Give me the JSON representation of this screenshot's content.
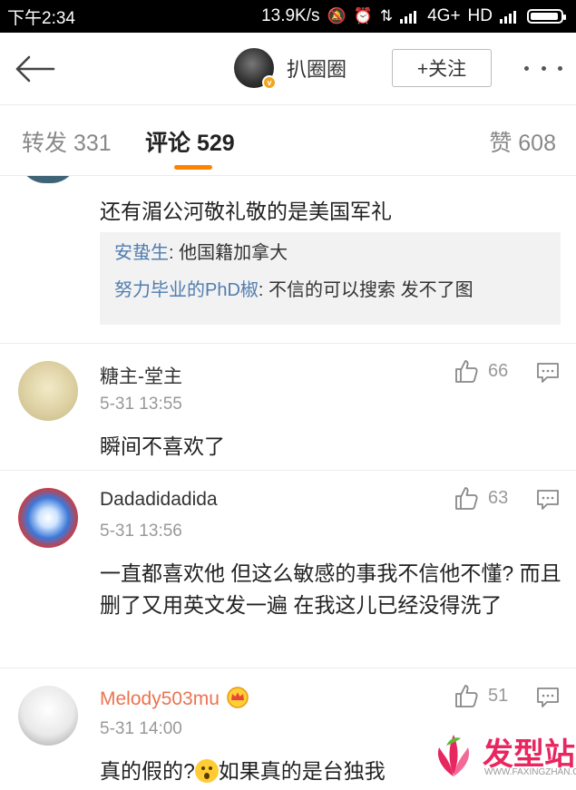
{
  "status_bar": {
    "time": "下午2:34",
    "speed": "13.9K/s",
    "network": "4G+",
    "hd": "HD"
  },
  "nav": {
    "back_icon": "arrow-left-icon",
    "user_name": "扒圈圈",
    "follow_label": "+关注",
    "more_icon": "more-dots-icon"
  },
  "tabs": {
    "repost": "转发 331",
    "comment": "评论 529",
    "like": "赞 608",
    "accent": "#ff8200"
  },
  "first_comment": {
    "text": "还有湄公河敬礼敬的是美国军礼",
    "replies": [
      {
        "name": "安蛰生",
        "text": ": 他国籍加拿大"
      },
      {
        "name": "努力毕业的PhD椒",
        "text": ": 不信的可以搜索 发不了图"
      }
    ]
  },
  "comments": [
    {
      "name": "糖主-堂主",
      "time": "5-31 13:55",
      "likes": "66",
      "text": "瞬间不喜欢了"
    },
    {
      "name": "Dadadidadida",
      "time": "5-31 13:56",
      "likes": "63",
      "text": "一直都喜欢他 但这么敏感的事我不信他不懂? 而且删了又用英文发一遍 在我这儿已经没得洗了"
    },
    {
      "name": "Melody503mu",
      "time": "5-31 14:00",
      "likes": "51",
      "text_a": "真的假的?",
      "text_b": "如果真的是台独我"
    }
  ],
  "watermark": {
    "text": "发型站",
    "url": "WWW.FAXINGZHAN.COM"
  },
  "colors": {
    "link_blue": "#507daf",
    "vip_orange": "#eb7350"
  }
}
